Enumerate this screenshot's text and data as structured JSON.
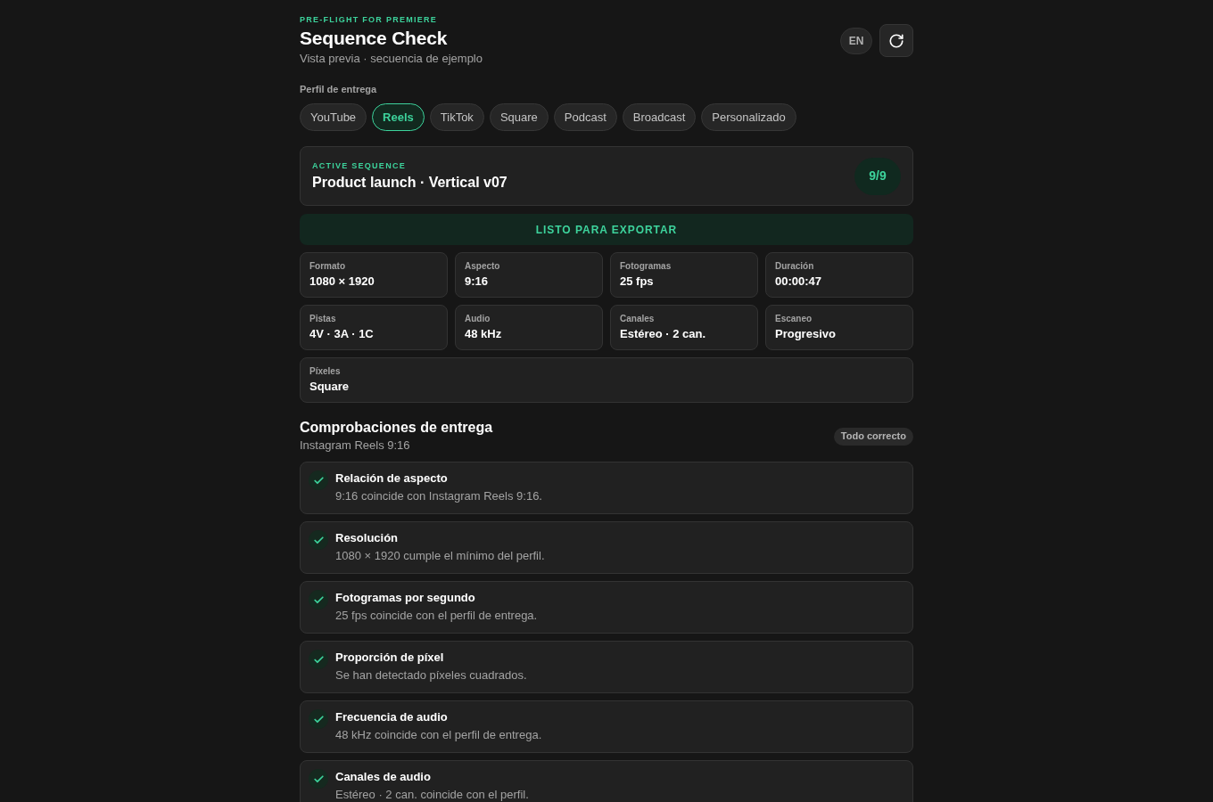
{
  "header": {
    "eyebrow": "PRE-FLIGHT FOR PREMIERE",
    "title": "Sequence Check",
    "subtitle": "Vista previa · secuencia de ejemplo",
    "language_button": "EN"
  },
  "profile": {
    "label": "Perfil de entrega",
    "tabs": [
      {
        "label": "YouTube",
        "selected": false
      },
      {
        "label": "Reels",
        "selected": true
      },
      {
        "label": "TikTok",
        "selected": false
      },
      {
        "label": "Square",
        "selected": false
      },
      {
        "label": "Podcast",
        "selected": false
      },
      {
        "label": "Broadcast",
        "selected": false
      },
      {
        "label": "Personalizado",
        "selected": false
      }
    ]
  },
  "active_sequence": {
    "label": "ACTIVE SEQUENCE",
    "name": "Product launch · Vertical v07",
    "score": "9/9"
  },
  "status_banner": "LISTO PARA EXPORTAR",
  "specs": [
    {
      "label": "Formato",
      "value": "1080 × 1920"
    },
    {
      "label": "Aspecto",
      "value": "9:16"
    },
    {
      "label": "Fotogramas",
      "value": "25 fps"
    },
    {
      "label": "Duración",
      "value": "00:00:47"
    },
    {
      "label": "Pistas",
      "value": "4V · 3A · 1C"
    },
    {
      "label": "Audio",
      "value": "48 kHz"
    },
    {
      "label": "Canales",
      "value": "Estéreo · 2 can."
    },
    {
      "label": "Escaneo",
      "value": "Progresivo"
    },
    {
      "label": "Píxeles",
      "value": "Square"
    }
  ],
  "checks": {
    "title": "Comprobaciones de entrega",
    "subtitle": "Instagram Reels 9:16",
    "badge": "Todo correcto",
    "items": [
      {
        "title": "Relación de aspecto",
        "description": "9:16 coincide con Instagram Reels 9:16.",
        "passed": true
      },
      {
        "title": "Resolución",
        "description": "1080 × 1920 cumple el mínimo del perfil.",
        "passed": true
      },
      {
        "title": "Fotogramas por segundo",
        "description": "25 fps coincide con el perfil de entrega.",
        "passed": true
      },
      {
        "title": "Proporción de píxel",
        "description": "Se han detectado píxeles cuadrados.",
        "passed": true
      },
      {
        "title": "Frecuencia de audio",
        "description": "48 kHz coincide con el perfil de entrega.",
        "passed": true
      },
      {
        "title": "Canales de audio",
        "description": "Estéreo · 2 can. coincide con el perfil.",
        "passed": true
      }
    ]
  }
}
